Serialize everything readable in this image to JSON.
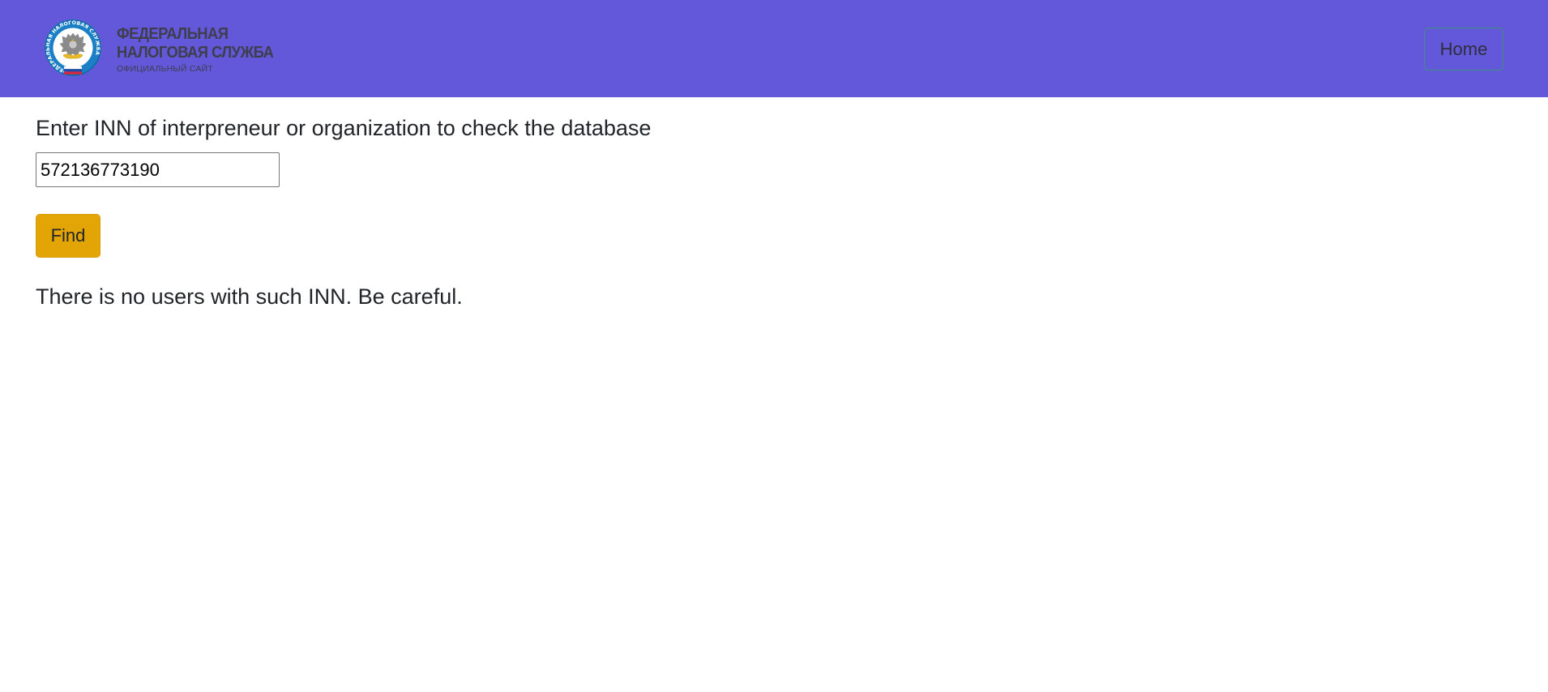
{
  "header": {
    "logo": {
      "icon": "fns-emblem-icon",
      "line1": "ФЕДЕРАЛЬНАЯ",
      "line2": "НАЛОГОВАЯ СЛУЖБА",
      "line3": "ОФИЦИАЛЬНЫЙ САЙТ",
      "emblem_ring_text": "ФЕДЕРАЛЬНАЯ НАЛОГОВАЯ СЛУЖБА"
    },
    "home_label": "Home",
    "background_color": "#6358d9"
  },
  "search": {
    "prompt": "Enter INN of interpreneur or organization to check the database",
    "inn_value": "572136773190",
    "find_label": "Find",
    "button_color": "#e3a506"
  },
  "result": {
    "message": "There is no users with such INN. Be careful."
  }
}
